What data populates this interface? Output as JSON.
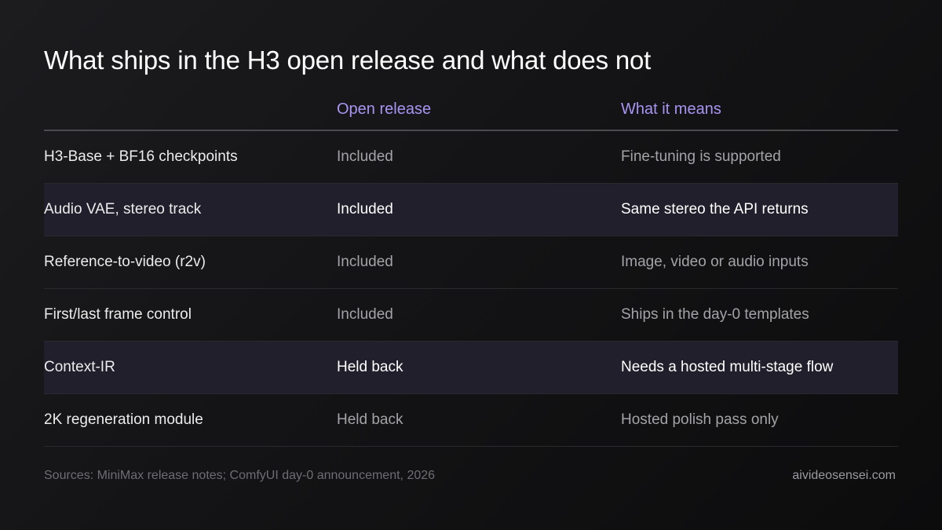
{
  "title": "What ships in the H3 open release and what does not",
  "table": {
    "headers": [
      "",
      "Open release",
      "What it means"
    ],
    "rows": [
      {
        "feature": "H3-Base + BF16 checkpoints",
        "status": "Included",
        "meaning": "Fine-tuning is supported",
        "highlighted": false
      },
      {
        "feature": "Audio VAE, stereo track",
        "status": "Included",
        "meaning": "Same stereo the API returns",
        "highlighted": true
      },
      {
        "feature": "Reference-to-video (r2v)",
        "status": "Included",
        "meaning": "Image, video or audio inputs",
        "highlighted": false
      },
      {
        "feature": "First/last frame control",
        "status": "Included",
        "meaning": "Ships in the day-0 templates",
        "highlighted": false
      },
      {
        "feature": "Context-IR",
        "status": "Held back",
        "meaning": "Needs a hosted multi-stage flow",
        "highlighted": true
      },
      {
        "feature": "2K regeneration module",
        "status": "Held back",
        "meaning": "Hosted polish pass only",
        "highlighted": false
      }
    ]
  },
  "footer": {
    "sources": "Sources: MiniMax release notes; ComfyUI day-0 announcement, 2026",
    "brand": "aivideosensei.com"
  },
  "colors": {
    "background": "#141416",
    "accent": "#a994f2",
    "highlight_row": "#211f2b",
    "muted_text": "#a3a3a8"
  }
}
